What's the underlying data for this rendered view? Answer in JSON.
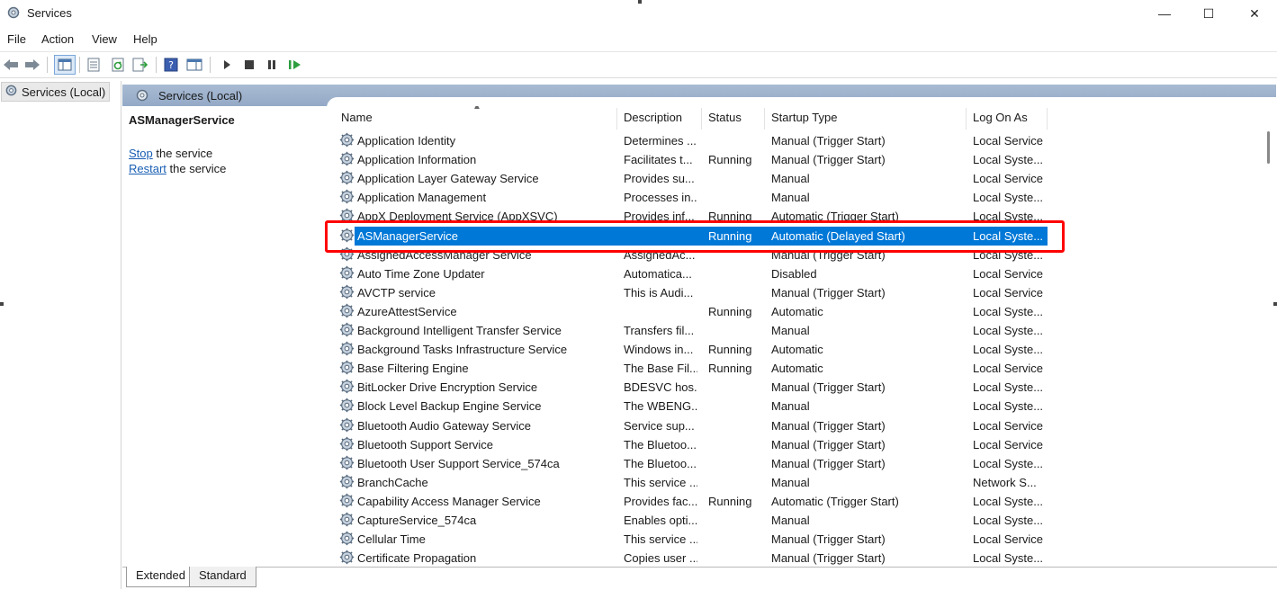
{
  "window": {
    "title": "Services",
    "minimize_glyph": "—",
    "maximize_glyph": "☐",
    "close_glyph": "✕"
  },
  "menu": [
    "File",
    "Action",
    "View",
    "Help"
  ],
  "toolbar_icons": [
    "back-arrow-icon",
    "forward-arrow-icon",
    "show-console-tree-icon",
    "properties-icon",
    "refresh-icon",
    "export-list-icon",
    "help-icon",
    "show-hide-action-pane-icon",
    "start-service-icon",
    "stop-service-icon",
    "pause-service-icon",
    "restart-service-icon"
  ],
  "tree": {
    "root_label": "Services (Local)"
  },
  "band_label": "Services (Local)",
  "details": {
    "service_name": "ASManagerService",
    "stop_link": "Stop",
    "stop_rest": " the service",
    "restart_link": "Restart",
    "restart_rest": " the service"
  },
  "columns": [
    "Name",
    "Description",
    "Status",
    "Startup Type",
    "Log On As"
  ],
  "rows": [
    {
      "name": "Application Identity",
      "desc": "Determines ...",
      "status": "",
      "startup": "Manual (Trigger Start)",
      "logon": "Local Service"
    },
    {
      "name": "Application Information",
      "desc": "Facilitates t...",
      "status": "Running",
      "startup": "Manual (Trigger Start)",
      "logon": "Local Syste..."
    },
    {
      "name": "Application Layer Gateway Service",
      "desc": "Provides su...",
      "status": "",
      "startup": "Manual",
      "logon": "Local Service"
    },
    {
      "name": "Application Management",
      "desc": "Processes in...",
      "status": "",
      "startup": "Manual",
      "logon": "Local Syste..."
    },
    {
      "name": "AppX Deployment Service (AppXSVC)",
      "desc": "Provides inf...",
      "status": "Running",
      "startup": "Automatic (Trigger Start)",
      "logon": "Local Syste..."
    },
    {
      "name": "ASManagerService",
      "desc": "",
      "status": "Running",
      "startup": "Automatic (Delayed Start)",
      "logon": "Local Syste...",
      "selected": true
    },
    {
      "name": "AssignedAccessManager Service",
      "desc": "AssignedAc...",
      "status": "",
      "startup": "Manual (Trigger Start)",
      "logon": "Local Syste..."
    },
    {
      "name": "Auto Time Zone Updater",
      "desc": "Automatica...",
      "status": "",
      "startup": "Disabled",
      "logon": "Local Service"
    },
    {
      "name": "AVCTP service",
      "desc": "This is Audi...",
      "status": "",
      "startup": "Manual (Trigger Start)",
      "logon": "Local Service"
    },
    {
      "name": "AzureAttestService",
      "desc": "",
      "status": "Running",
      "startup": "Automatic",
      "logon": "Local Syste..."
    },
    {
      "name": "Background Intelligent Transfer Service",
      "desc": "Transfers fil...",
      "status": "",
      "startup": "Manual",
      "logon": "Local Syste..."
    },
    {
      "name": "Background Tasks Infrastructure Service",
      "desc": "Windows in...",
      "status": "Running",
      "startup": "Automatic",
      "logon": "Local Syste..."
    },
    {
      "name": "Base Filtering Engine",
      "desc": "The Base Fil...",
      "status": "Running",
      "startup": "Automatic",
      "logon": "Local Service"
    },
    {
      "name": "BitLocker Drive Encryption Service",
      "desc": "BDESVC hos...",
      "status": "",
      "startup": "Manual (Trigger Start)",
      "logon": "Local Syste..."
    },
    {
      "name": "Block Level Backup Engine Service",
      "desc": "The WBENG...",
      "status": "",
      "startup": "Manual",
      "logon": "Local Syste..."
    },
    {
      "name": "Bluetooth Audio Gateway Service",
      "desc": "Service sup...",
      "status": "",
      "startup": "Manual (Trigger Start)",
      "logon": "Local Service"
    },
    {
      "name": "Bluetooth Support Service",
      "desc": "The Bluetoo...",
      "status": "",
      "startup": "Manual (Trigger Start)",
      "logon": "Local Service"
    },
    {
      "name": "Bluetooth User Support Service_574ca",
      "desc": "The Bluetoo...",
      "status": "",
      "startup": "Manual (Trigger Start)",
      "logon": "Local Syste..."
    },
    {
      "name": "BranchCache",
      "desc": "This service ...",
      "status": "",
      "startup": "Manual",
      "logon": "Network S..."
    },
    {
      "name": "Capability Access Manager Service",
      "desc": "Provides fac...",
      "status": "Running",
      "startup": "Automatic (Trigger Start)",
      "logon": "Local Syste..."
    },
    {
      "name": "CaptureService_574ca",
      "desc": "Enables opti...",
      "status": "",
      "startup": "Manual",
      "logon": "Local Syste..."
    },
    {
      "name": "Cellular Time",
      "desc": "This service ...",
      "status": "",
      "startup": "Manual (Trigger Start)",
      "logon": "Local Service"
    },
    {
      "name": "Certificate Propagation",
      "desc": "Copies user ...",
      "status": "",
      "startup": "Manual (Trigger Start)",
      "logon": "Local Syste..."
    }
  ],
  "tabs": [
    "Extended",
    "Standard"
  ],
  "colors": {
    "selection": "#0078d7",
    "highlight_box": "#ff0000",
    "band": "#a9bbd3",
    "link": "#1a5fb4"
  }
}
